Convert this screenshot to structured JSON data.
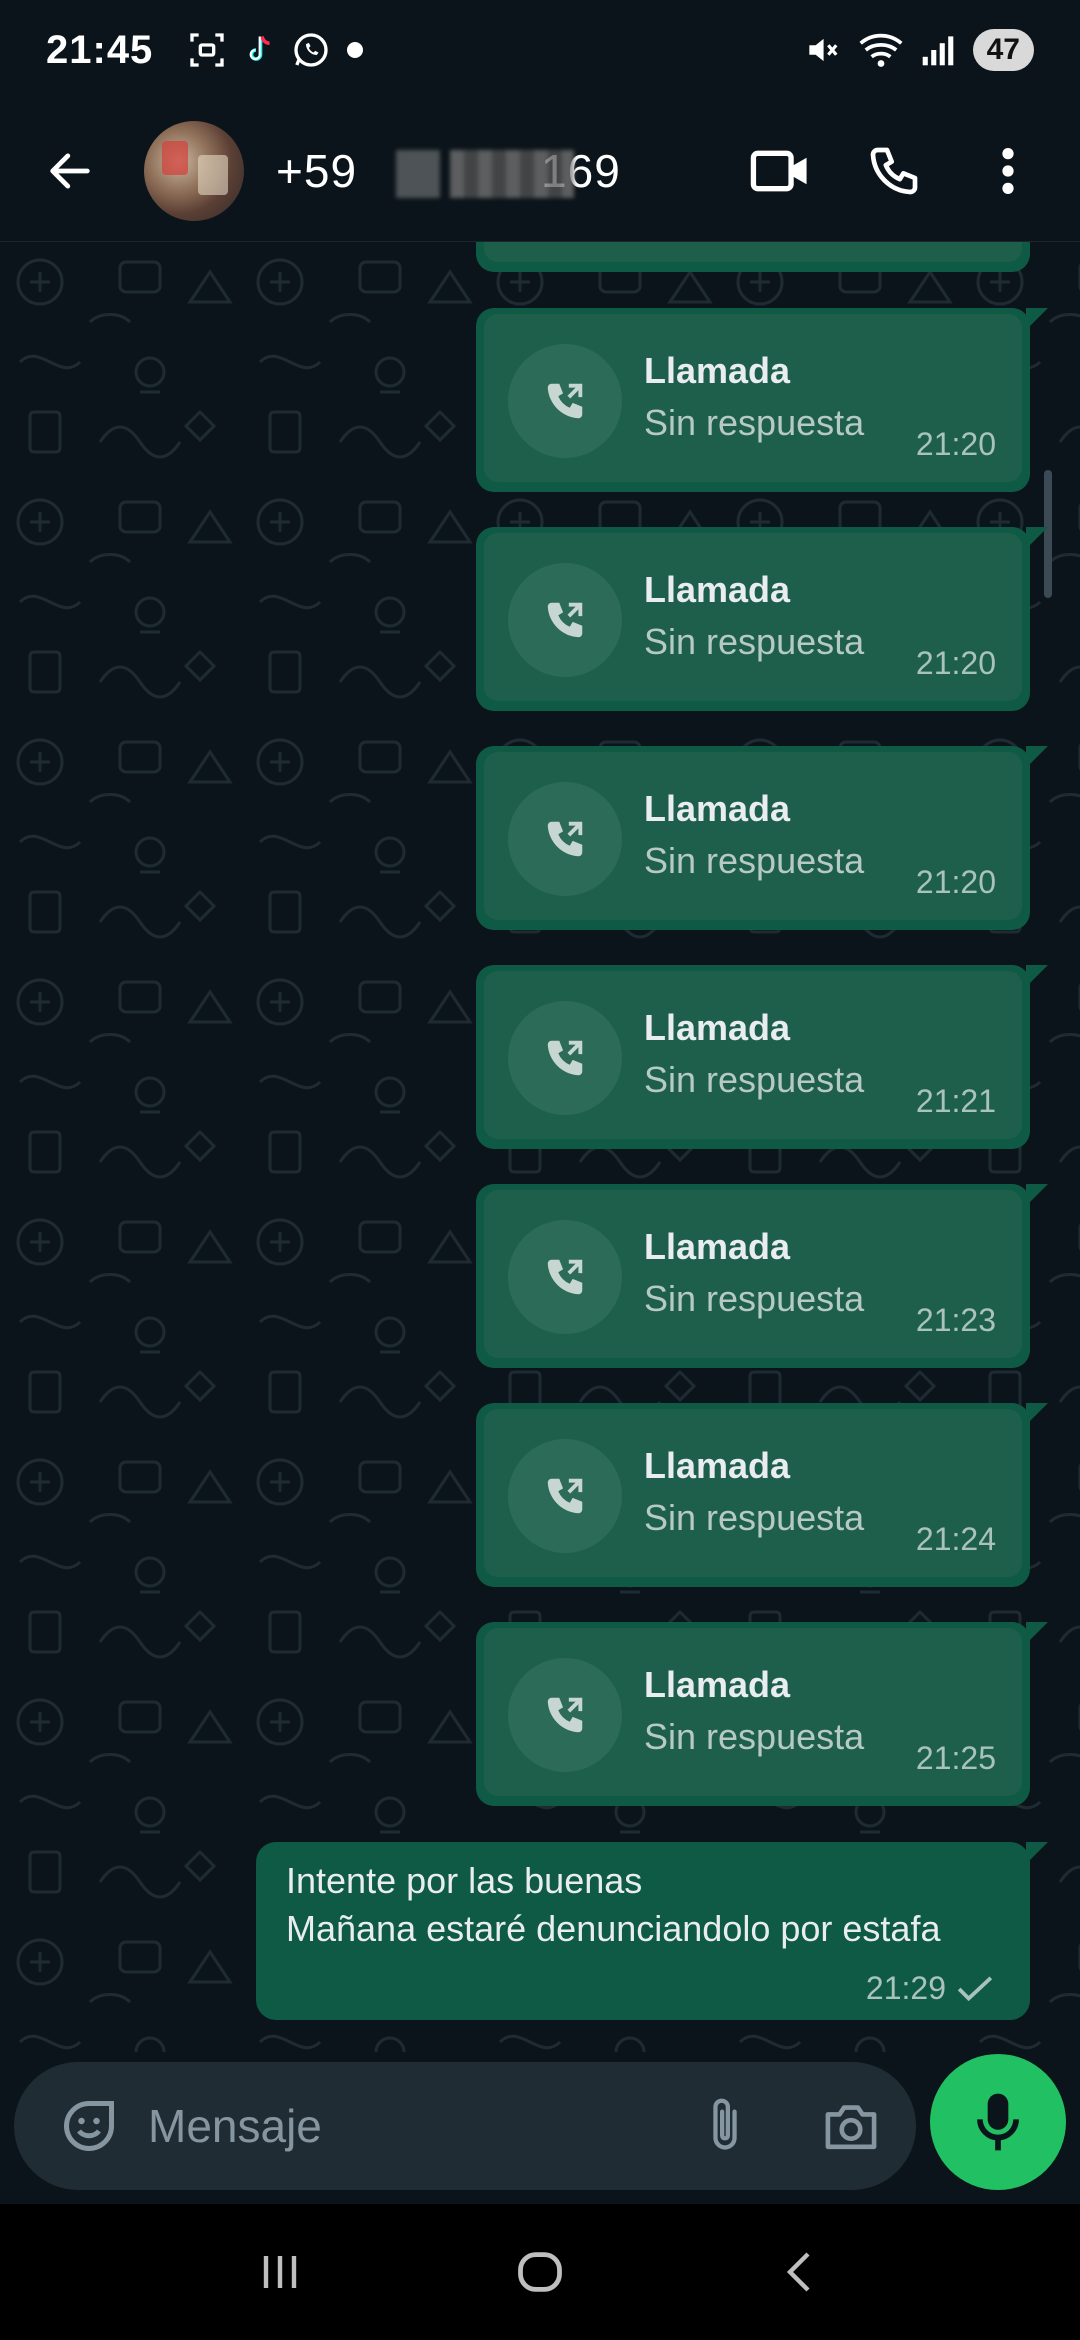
{
  "status_bar": {
    "time": "21:45",
    "battery": "47",
    "icons": [
      "screenshot-icon",
      "tiktok-icon",
      "whatsapp-icon",
      "dot-icon",
      "mute-icon",
      "wifi-icon",
      "signal-icon"
    ]
  },
  "header": {
    "contact_prefix": "+59",
    "contact_suffix": "169",
    "icons": [
      "back-arrow-icon",
      "video-call-icon",
      "phone-icon",
      "more-vert-icon"
    ]
  },
  "calls": [
    {
      "title": "Llamada",
      "subtitle": "Sin respuesta",
      "time": "21:20"
    },
    {
      "title": "Llamada",
      "subtitle": "Sin respuesta",
      "time": "21:20"
    },
    {
      "title": "Llamada",
      "subtitle": "Sin respuesta",
      "time": "21:20"
    },
    {
      "title": "Llamada",
      "subtitle": "Sin respuesta",
      "time": "21:21"
    },
    {
      "title": "Llamada",
      "subtitle": "Sin respuesta",
      "time": "21:23"
    },
    {
      "title": "Llamada",
      "subtitle": "Sin respuesta",
      "time": "21:24"
    },
    {
      "title": "Llamada",
      "subtitle": "Sin respuesta",
      "time": "21:25"
    }
  ],
  "message": {
    "line1": "Intente por las buenas",
    "line2": "Mañana estaré denunciandolo por estafa",
    "time": "21:29",
    "status_icon": "single-check-icon"
  },
  "composer": {
    "placeholder": "Mensaje",
    "icons": [
      "sticker-icon",
      "attach-icon",
      "camera-icon",
      "mic-icon"
    ]
  },
  "colors": {
    "background": "#0b141a",
    "outgoing_bubble": "#0e5a45",
    "accent": "#21c063"
  }
}
